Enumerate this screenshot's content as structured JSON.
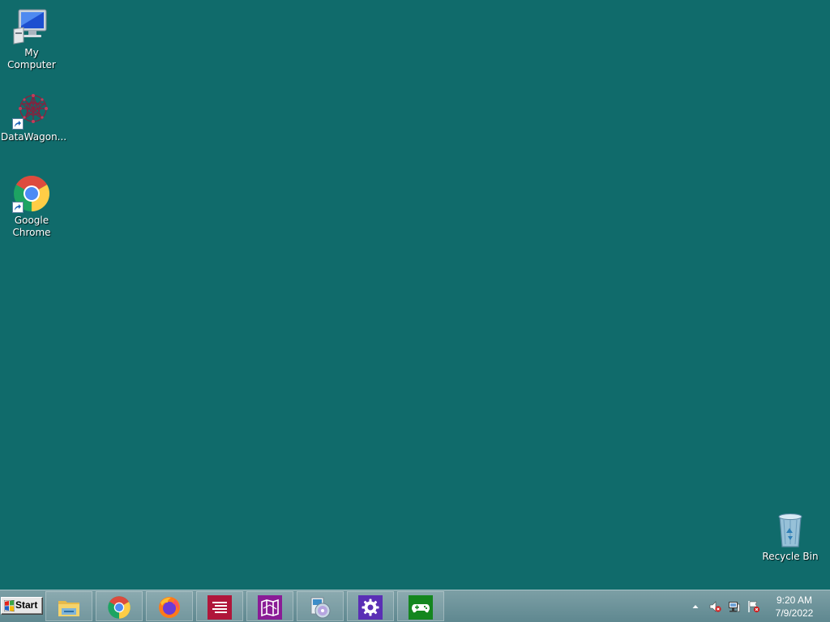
{
  "desktop": {
    "background_color": "#106b6b",
    "icons": [
      {
        "label": "My Computer",
        "icon": "computer-icon"
      },
      {
        "label": "DataWagon...",
        "icon": "datawagon-icon",
        "shortcut": true
      },
      {
        "label": "Google\nChrome",
        "icon": "chrome-icon",
        "shortcut": true
      },
      {
        "label": "Recycle Bin",
        "icon": "recycle-bin-icon"
      }
    ]
  },
  "taskbar": {
    "start_label": "Start",
    "pinned": [
      {
        "name": "file-explorer",
        "icon": "folder-icon"
      },
      {
        "name": "google-chrome",
        "icon": "chrome-icon"
      },
      {
        "name": "firefox",
        "icon": "firefox-icon"
      },
      {
        "name": "text-editor",
        "icon": "text-lines-icon",
        "color": "#b0163a"
      },
      {
        "name": "maps",
        "icon": "map-icon",
        "color": "#8a1c96"
      },
      {
        "name": "media-player",
        "icon": "disc-icon"
      },
      {
        "name": "settings",
        "icon": "gear-icon",
        "color": "#5a2fb5"
      },
      {
        "name": "xbox",
        "icon": "controller-icon",
        "color": "#14861f"
      }
    ],
    "tray": {
      "show_hidden_icon": "up-arrow-icon",
      "icons": [
        "volume-muted-icon",
        "network-icon",
        "action-center-icon"
      ]
    },
    "clock": {
      "time": "9:20 AM",
      "date": "7/9/2022"
    }
  }
}
